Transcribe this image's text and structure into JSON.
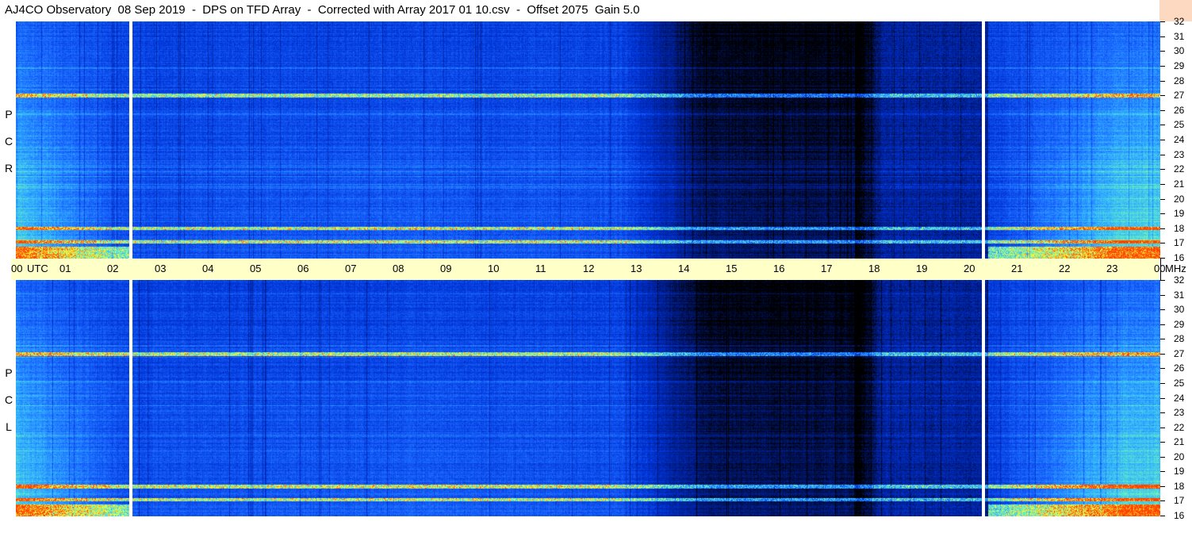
{
  "title": "AJ4CO Observatory  08 Sep 2019  -  DPS on TFD Array  -  Corrected with Array 2017 01 10.csv  -  Offset 2075  Gain 5.0",
  "colors": {
    "axis_background": "#ffffc8",
    "corner_background": "#fcd9c0",
    "colormap": [
      "#000000",
      "#001a80",
      "#0033d6",
      "#1a66ff",
      "#33b3ff",
      "#66f2c0",
      "#ffff33",
      "#ff4000"
    ]
  },
  "polarizations": {
    "top": [
      "R",
      "C",
      "P"
    ],
    "bottom": [
      "L",
      "C",
      "P"
    ]
  },
  "time_axis": {
    "labels": [
      "00",
      "UTC",
      "01",
      "02",
      "03",
      "04",
      "05",
      "06",
      "07",
      "08",
      "09",
      "10",
      "11",
      "12",
      "13",
      "14",
      "15",
      "16",
      "17",
      "18",
      "19",
      "20",
      "21",
      "22",
      "23",
      "00",
      "MHz"
    ]
  },
  "freq_axis": {
    "labels": [
      "32",
      "31",
      "30",
      "29",
      "28",
      "27",
      "26",
      "25",
      "24",
      "23",
      "22",
      "21",
      "20",
      "19",
      "18",
      "17",
      "16"
    ]
  },
  "chart_data": [
    {
      "type": "heatmap",
      "title": "AJ4CO Observatory  08 Sep 2019  -  DPS on TFD Array  -  Corrected with Array 2017 01 10.csv  -  Offset 2075  Gain 5.0",
      "panel": "RCP",
      "x_range_utc_hours": [
        0,
        24
      ],
      "y_range_mhz": [
        16,
        32
      ],
      "data_gaps_utc_hours": [
        [
          2.38,
          2.44
        ],
        [
          20.35,
          20.41
        ]
      ],
      "dark_region_utc_hours": [
        14.5,
        17.6
      ],
      "interference_bands_mhz": [
        17.1,
        18.0,
        27.0
      ]
    },
    {
      "type": "heatmap",
      "panel": "LCP",
      "x_range_utc_hours": [
        0,
        24
      ],
      "y_range_mhz": [
        16,
        32
      ],
      "data_gaps_utc_hours": [
        [
          2.38,
          2.44
        ],
        [
          20.35,
          20.41
        ]
      ],
      "dark_region_utc_hours": [
        14.5,
        17.6
      ],
      "interference_bands_mhz": [
        17.1,
        18.0,
        27.0
      ]
    }
  ]
}
